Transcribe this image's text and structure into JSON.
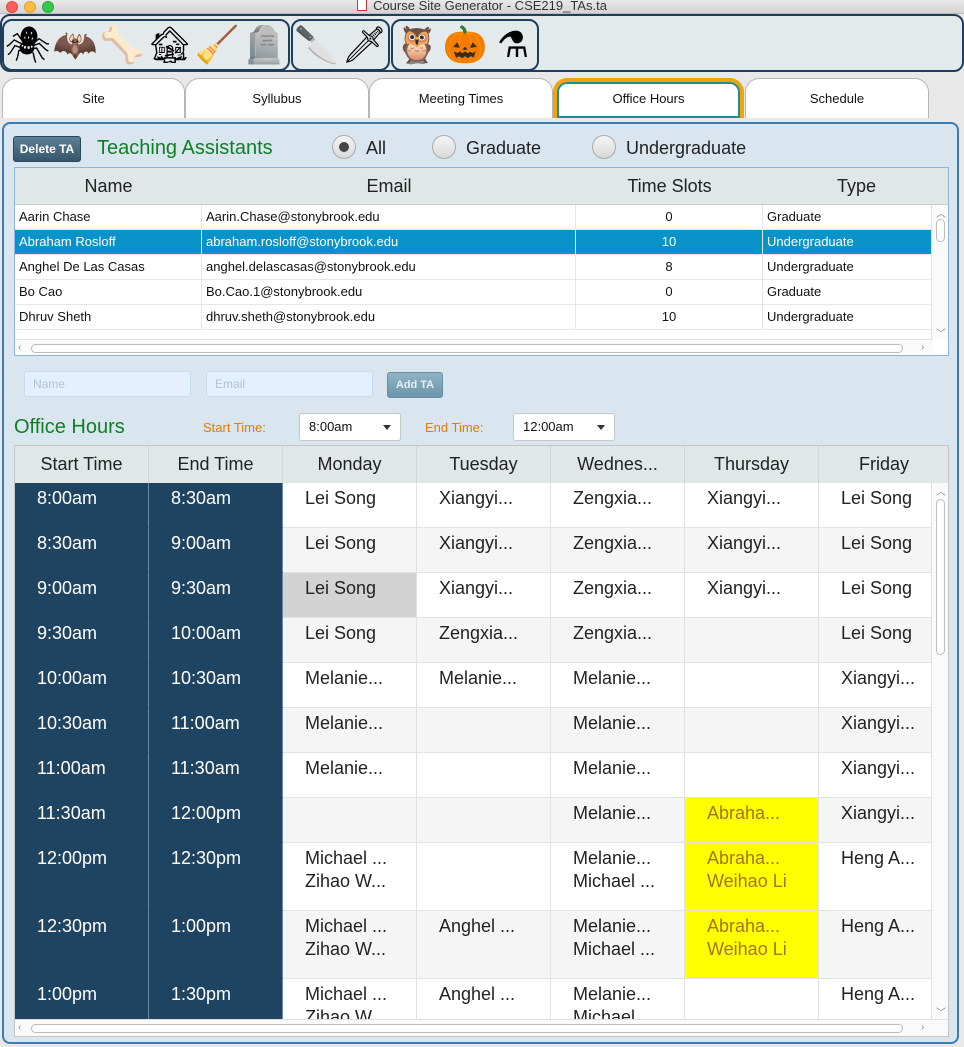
{
  "window": {
    "title": "Course Site Generator - CSE219_TAs.ta"
  },
  "toolbar": {
    "group1": [
      "spider-icon",
      "bat-icon",
      "crossbones-icon",
      "haunted-house-icon",
      "witch-broom-icon",
      "tombstone-icon"
    ],
    "group2": [
      "cleaver-icon",
      "bloody-knife-icon"
    ],
    "group3": [
      "owl-icon",
      "pumpkin-icon",
      "cauldron-icon"
    ],
    "glyphs": {
      "spider-icon": "🕷",
      "bat-icon": "🦇",
      "crossbones-icon": "🦴",
      "haunted-house-icon": "🏚",
      "witch-broom-icon": "🧹",
      "tombstone-icon": "🪦",
      "cleaver-icon": "🔪",
      "bloody-knife-icon": "🗡",
      "owl-icon": "🦉",
      "pumpkin-icon": "🎃",
      "cauldron-icon": "⚗"
    }
  },
  "tabs": [
    "Site",
    "Syllubus",
    "Meeting Times",
    "Office Hours",
    "Schedule"
  ],
  "ta_section": {
    "delete_label": "Delete TA",
    "title": "Teaching Assistants",
    "radio_all": "All",
    "radio_grad": "Graduate",
    "radio_undergrad": "Undergraduate",
    "columns": [
      "Name",
      "Email",
      "Time Slots",
      "Type"
    ],
    "rows": [
      [
        "Aarin Chase",
        "Aarin.Chase@stonybrook.edu",
        "0",
        "Graduate"
      ],
      [
        "Abraham Rosloff",
        "abraham.rosloff@stonybrook.edu",
        "10",
        "Undergraduate"
      ],
      [
        "Anghel De Las Casas",
        "anghel.delascasas@stonybrook.edu",
        "8",
        "Undergraduate"
      ],
      [
        "Bo Cao",
        "Bo.Cao.1@stonybrook.edu",
        "0",
        "Graduate"
      ],
      [
        "Dhruv Sheth",
        "dhruv.sheth@stonybrook.edu",
        "10",
        "Undergraduate"
      ]
    ],
    "name_placeholder": "Name",
    "email_placeholder": "Email",
    "add_label": "Add TA"
  },
  "office_hours": {
    "title": "Office Hours",
    "start_label": "Start Time:",
    "start_value": "8:00am",
    "end_label": "End Time:",
    "end_value": "12:00am",
    "columns": [
      "Start Time",
      "End Time",
      "Monday",
      "Tuesday",
      "Wednes...",
      "Thursday",
      "Friday"
    ],
    "rows": [
      [
        "8:00am",
        "8:30am",
        "Lei Song",
        "Xiangyi...",
        "Zengxia...",
        "Xiangyi...",
        "Lei Song"
      ],
      [
        "8:30am",
        "9:00am",
        "Lei Song",
        "Xiangyi...",
        "Zengxia...",
        "Xiangyi...",
        "Lei Song"
      ],
      [
        "9:00am",
        "9:30am",
        "Lei Song",
        "Xiangyi...",
        "Zengxia...",
        "Xiangyi...",
        "Lei Song"
      ],
      [
        "9:30am",
        "10:00am",
        "Lei Song",
        "Zengxia...",
        "Zengxia...",
        "",
        "Lei Song"
      ],
      [
        "10:00am",
        "10:30am",
        "Melanie...",
        "Melanie...",
        "Melanie...",
        "",
        "Xiangyi..."
      ],
      [
        "10:30am",
        "11:00am",
        "Melanie...",
        "",
        "Melanie...",
        "",
        "Xiangyi..."
      ],
      [
        "11:00am",
        "11:30am",
        "Melanie...",
        "",
        "Melanie...",
        "",
        "Xiangyi..."
      ],
      [
        "11:30am",
        "12:00pm",
        "",
        "",
        "Melanie...",
        "Abraha...",
        "Xiangyi..."
      ],
      [
        "12:00pm",
        "12:30pm",
        "Michael ...\nZihao W...",
        "",
        "Melanie...\nMichael ...",
        "Abraha...\nWeihao Li",
        "Heng A..."
      ],
      [
        "12:30pm",
        "1:00pm",
        "Michael ...\nZihao W...",
        "Anghel ...",
        "Melanie...\nMichael ...",
        "Abraha...\nWeihao Li",
        "Heng A..."
      ],
      [
        "1:00pm",
        "1:30pm",
        "Michael ...\nZihao W...",
        "Anghel ...",
        "Melanie...\nMichael ...",
        "",
        "Heng A..."
      ]
    ],
    "highlight_color": "#ffff00",
    "selected_cell_color": "#d3d3d3"
  },
  "colors": {
    "accent_blue": "#3d7bb5",
    "time_column": "#1e4461",
    "title_green": "#117e25",
    "label_orange": "#e07d00",
    "selection_blue": "#0a93c8"
  }
}
